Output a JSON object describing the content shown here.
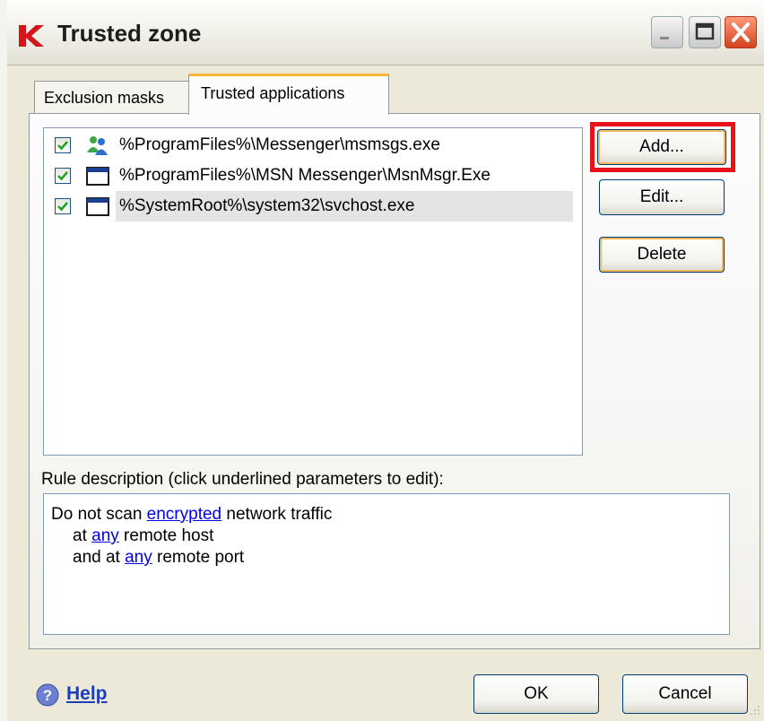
{
  "window": {
    "title": "Trusted zone",
    "accent_color": "#e8121c"
  },
  "tabs": [
    {
      "label": "Exclusion masks",
      "active": false
    },
    {
      "label": "Trusted applications",
      "active": true
    }
  ],
  "apps": [
    {
      "path": "%ProgramFiles%\\Messenger\\msmsgs.exe",
      "checked": true,
      "icon": "messenger-people-icon"
    },
    {
      "path": "%ProgramFiles%\\MSN Messenger\\MsnMsgr.Exe",
      "checked": true,
      "icon": "application-window-icon"
    },
    {
      "path": "%SystemRoot%\\system32\\svchost.exe",
      "checked": true,
      "icon": "application-window-icon",
      "selected": true
    }
  ],
  "buttons": {
    "add": "Add...",
    "edit": "Edit...",
    "delete": "Delete",
    "ok": "OK",
    "cancel": "Cancel"
  },
  "rule": {
    "label": "Rule description (click underlined parameters to edit):",
    "line1_pre": "Do not scan ",
    "line1_link": "encrypted",
    "line1_post": " network traffic",
    "line2_pre": "at ",
    "line2_link": "any",
    "line2_post": " remote host",
    "line3_pre": "and at ",
    "line3_link": "any",
    "line3_post": " remote port"
  },
  "help": {
    "label": "Help"
  }
}
